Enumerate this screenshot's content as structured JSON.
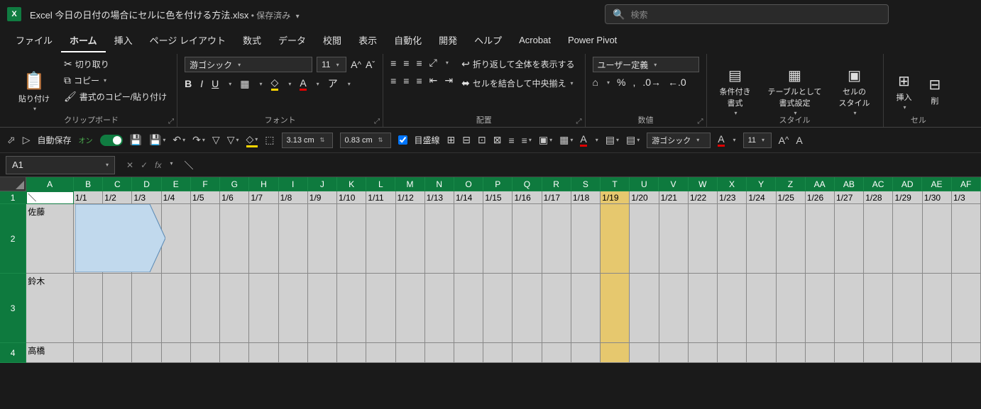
{
  "title": {
    "filename": "Excel 今日の日付の場合にセルに色を付ける方法.xlsx",
    "saved": "保存済み"
  },
  "search": {
    "placeholder": "検索"
  },
  "menu": {
    "file": "ファイル",
    "home": "ホーム",
    "insert": "挿入",
    "pagelayout": "ページ レイアウト",
    "formulas": "数式",
    "data": "データ",
    "review": "校閲",
    "view": "表示",
    "automate": "自動化",
    "developer": "開発",
    "help": "ヘルプ",
    "acrobat": "Acrobat",
    "powerpivot": "Power Pivot"
  },
  "ribbon": {
    "clipboard": {
      "paste": "貼り付け",
      "cut": "切り取り",
      "copy": "コピー",
      "formatpainter": "書式のコピー/貼り付け",
      "label": "クリップボード"
    },
    "font": {
      "family": "游ゴシック",
      "size": "11",
      "label": "フォント"
    },
    "alignment": {
      "wrap": "折り返して全体を表示する",
      "merge": "セルを結合して中央揃え",
      "label": "配置"
    },
    "number": {
      "format": "ユーザー定義",
      "label": "数値"
    },
    "styles": {
      "condfmt": "条件付き\n書式",
      "tablefmt": "テーブルとして\n書式設定",
      "cellstyles": "セルの\nスタイル",
      "label": "スタイル"
    },
    "cells": {
      "insert": "挿入",
      "delete": "削",
      "label": "セル"
    }
  },
  "qat": {
    "autosave": "自動保存",
    "on": "オン",
    "gridline": "目盛線",
    "height": "3.13 cm",
    "width": "0.83 cm",
    "font": "游ゴシック",
    "size": "11"
  },
  "formulabar": {
    "namebox": "A1",
    "formula": "＼"
  },
  "columns": [
    "A",
    "B",
    "C",
    "D",
    "E",
    "F",
    "G",
    "H",
    "I",
    "J",
    "K",
    "L",
    "M",
    "N",
    "O",
    "P",
    "Q",
    "R",
    "S",
    "T",
    "U",
    "V",
    "W",
    "X",
    "Y",
    "Z",
    "AA",
    "AB",
    "AC",
    "AD",
    "AE",
    "AF"
  ],
  "dates": [
    "1/1",
    "1/2",
    "1/3",
    "1/4",
    "1/5",
    "1/6",
    "1/7",
    "1/8",
    "1/9",
    "1/10",
    "1/11",
    "1/12",
    "1/13",
    "1/14",
    "1/15",
    "1/16",
    "1/17",
    "1/18",
    "1/19",
    "1/20",
    "1/21",
    "1/22",
    "1/23",
    "1/24",
    "1/25",
    "1/26",
    "1/27",
    "1/28",
    "1/29",
    "1/30",
    "1/3"
  ],
  "today_col_index": 18,
  "names": {
    "r2": "佐藤",
    "r3": "鈴木",
    "r4": "高橋"
  },
  "diag": "＼"
}
